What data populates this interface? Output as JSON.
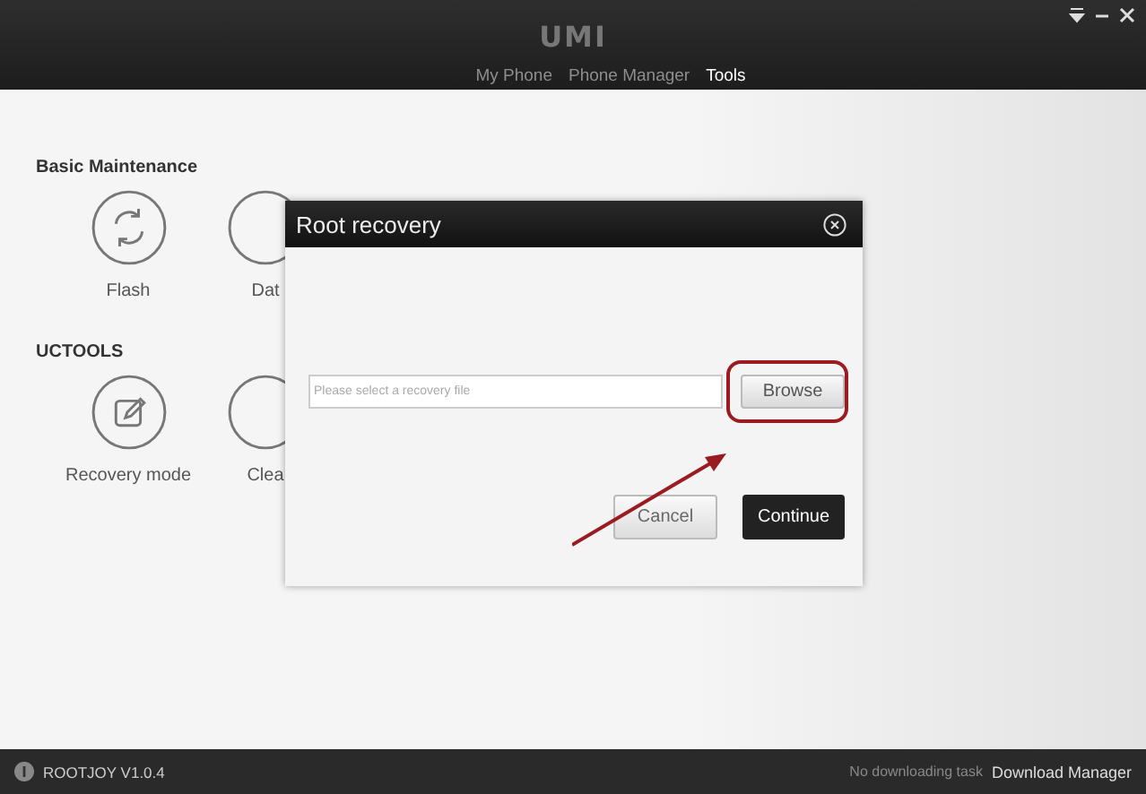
{
  "header": {
    "logo": "UMI",
    "nav": [
      {
        "label": "My Phone",
        "selected": false
      },
      {
        "label": "Phone Manager",
        "selected": false
      },
      {
        "label": "Tools",
        "selected": true
      }
    ]
  },
  "sections": [
    {
      "title": "Basic Maintenance",
      "tools": [
        {
          "kind": "flash",
          "label": "Flash"
        },
        {
          "kind": "data",
          "label": "Dat"
        }
      ]
    },
    {
      "title": "UCTOOLS",
      "tools": [
        {
          "kind": "recovery",
          "label": "Recovery mode"
        },
        {
          "kind": "clear",
          "label": "Clea"
        }
      ]
    }
  ],
  "dialog": {
    "title": "Root recovery",
    "field": {
      "placeholder": "Please select a recovery file"
    },
    "browse": "Browse",
    "buttons": [
      {
        "kind": "secondary",
        "label": "Cancel"
      },
      {
        "kind": "primary",
        "label": "Continue"
      }
    ]
  },
  "status_bar": {
    "app": "ROOTJOY V1.0.4",
    "task": "No downloading task",
    "link": "Download Manager"
  }
}
